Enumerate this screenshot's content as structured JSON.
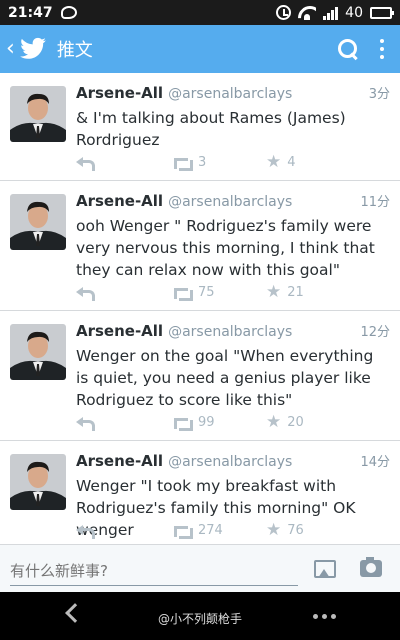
{
  "status_bar": {
    "time": "21:47",
    "signal_label": "40",
    "battery_color": "#5ad14a"
  },
  "app_bar": {
    "title": "推文",
    "bg_color": "#55acee"
  },
  "tweets": [
    {
      "name": "Arsene-All",
      "handle": "@arsenalbarclays",
      "time": "3分",
      "text": "& I'm talking about Rames (James) Rordriguez",
      "retweets": "3",
      "favorites": "4"
    },
    {
      "name": "Arsene-All",
      "handle": "@arsenalbarclays",
      "time": "11分",
      "text": "ooh Wenger \" Rodriguez's family were very nervous this morning, I think that they can relax now with this goal\"",
      "retweets": "75",
      "favorites": "21"
    },
    {
      "name": "Arsene-All",
      "handle": "@arsenalbarclays",
      "time": "12分",
      "text": "Wenger on the goal \"When everything is quiet, you need a genius player like Rodriguez to score like this\"",
      "retweets": "99",
      "favorites": "20"
    },
    {
      "name": "Arsene-All",
      "handle": "@arsenalbarclays",
      "time": "14分",
      "text": "Wenger \"I took my breakfast with Rodriguez's family this morning\" OK wenger",
      "retweets": "274",
      "favorites": "76"
    }
  ],
  "composer": {
    "placeholder": "有什么新鲜事?"
  },
  "nav_bar": {
    "watermark": "@小不列颠枪手"
  }
}
